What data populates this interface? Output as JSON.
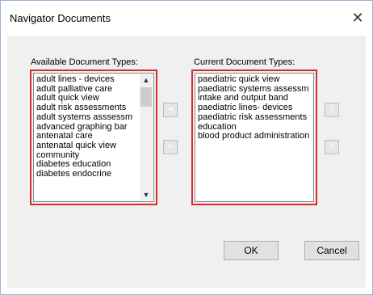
{
  "window": {
    "title": "Navigator Documents",
    "close_glyph": "✕"
  },
  "available": {
    "label": "Available Document Types:",
    "items": [
      "adult lines - devices",
      "adult palliative care",
      "adult quick view",
      "adult risk assessments",
      "adult systems asssessm",
      "advanced graphing bar",
      "antenatal care",
      "antenatal quick view",
      "community",
      "diabetes education",
      "diabetes endocrine"
    ]
  },
  "current": {
    "label": "Current Document Types:",
    "items": [
      "paediatric quick view",
      "paediatric systems assessm",
      "intake and output band",
      "paediatric lines- devices",
      "paediatric risk assessments",
      "education",
      "blood product administration"
    ]
  },
  "buttons": {
    "ok": "OK",
    "cancel": "Cancel"
  },
  "icons": {
    "add": "arrow-right-icon",
    "remove": "arrow-left-icon",
    "move_up": "arrow-up-icon",
    "move_down": "arrow-down-icon",
    "scroll_up": "chevron-up-icon",
    "scroll_down": "chevron-down-icon"
  },
  "colors": {
    "highlight_border": "#d92b2b",
    "window_border": "#9ab3d4",
    "dialog_bg": "#f0f0f0"
  }
}
